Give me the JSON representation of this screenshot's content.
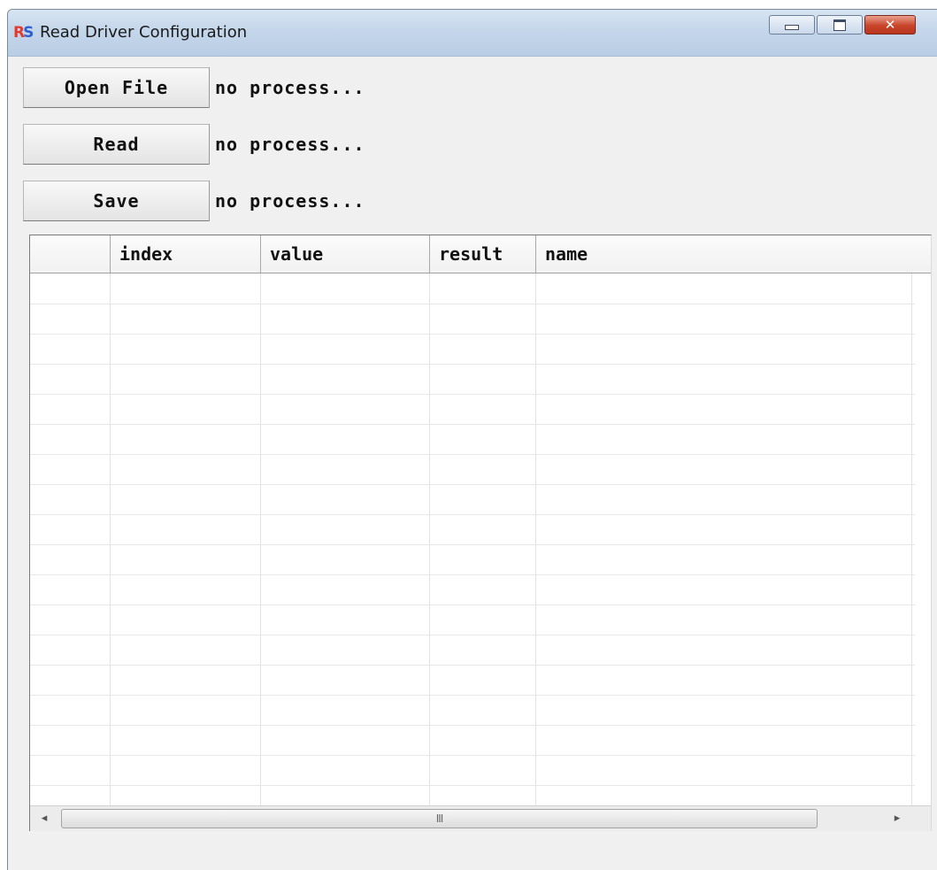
{
  "window": {
    "title": "Read Driver Configuration",
    "app_icon": "rs-app-icon",
    "icon_letter_1": "R",
    "icon_letter_2": "S",
    "controls": {
      "minimize": "minimize-icon",
      "maximize": "maximize-icon",
      "close": "close-icon",
      "close_glyph": "✕"
    }
  },
  "actions": [
    {
      "label": "Open File",
      "status": "no process..."
    },
    {
      "label": "Read",
      "status": "no process..."
    },
    {
      "label": "Save",
      "status": "no process..."
    }
  ],
  "table": {
    "columns": [
      "",
      "index",
      "value",
      "result",
      "name"
    ],
    "rows": []
  },
  "scrollbar": {
    "left_arrow": "◂",
    "right_arrow": "▸",
    "grip": "III"
  },
  "colors": {
    "close_button": "#c9452a",
    "window_background": "#f0f0f0"
  }
}
